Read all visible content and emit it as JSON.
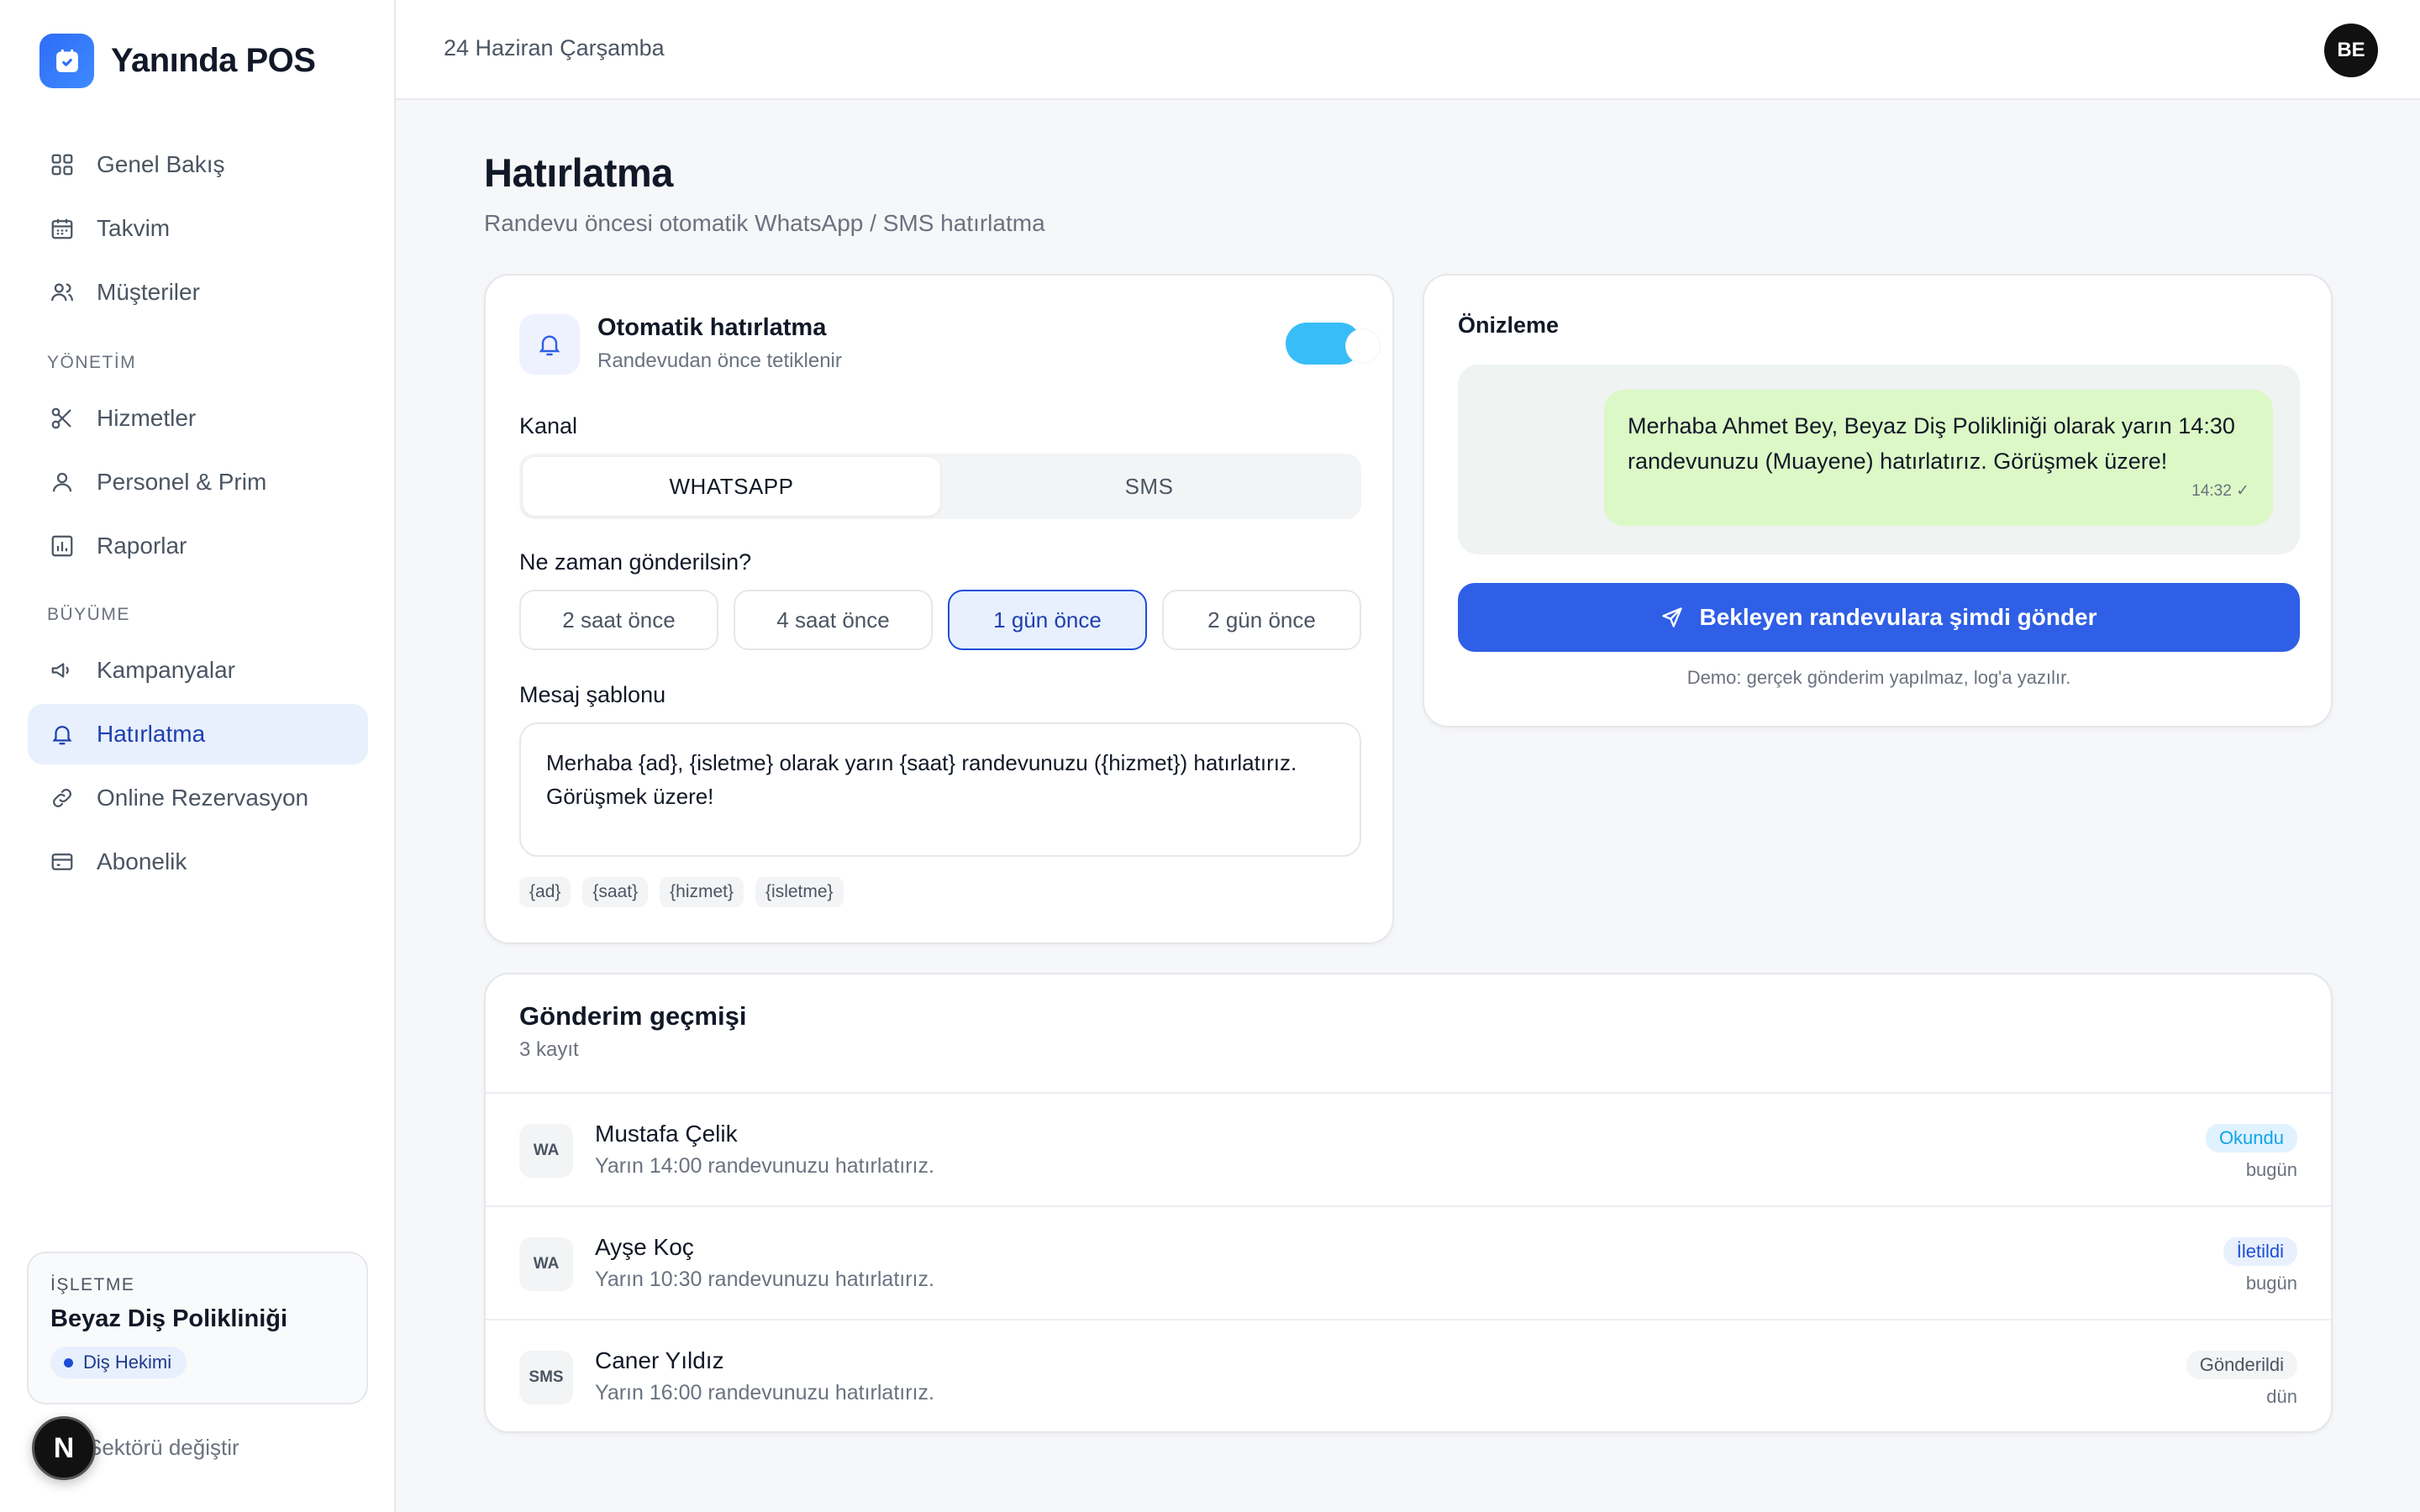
{
  "brand": {
    "name": "Yanında POS",
    "color": "#2f6cf6"
  },
  "sidebar": {
    "items_top": [
      {
        "label": "Genel Bakış",
        "icon": "grid-icon"
      },
      {
        "label": "Takvim",
        "icon": "calendar-icon"
      },
      {
        "label": "Müşteriler",
        "icon": "users-icon"
      }
    ],
    "section_management": "YÖNETİM",
    "items_management": [
      {
        "label": "Hizmetler",
        "icon": "scissors-icon"
      },
      {
        "label": "Personel & Prim",
        "icon": "user-icon"
      },
      {
        "label": "Raporlar",
        "icon": "bar-chart-icon"
      }
    ],
    "section_growth": "BÜYÜME",
    "items_growth": [
      {
        "label": "Kampanyalar",
        "icon": "megaphone-icon"
      },
      {
        "label": "Hatırlatma",
        "icon": "bell-icon",
        "active": true
      },
      {
        "label": "Online Rezervasyon",
        "icon": "link-icon"
      },
      {
        "label": "Abonelik",
        "icon": "credit-card-icon"
      }
    ],
    "business": {
      "label": "İŞLETME",
      "name": "Beyaz Diş Polikliniği",
      "sector": "Diş Hekimi"
    },
    "sector_link": "Sektörü değiştir",
    "n_badge": "N"
  },
  "topbar": {
    "date": "24 Haziran Çarşamba",
    "avatar_initials": "BE"
  },
  "page": {
    "title": "Hatırlatma",
    "subtitle": "Randevu öncesi otomatik WhatsApp / SMS hatırlatma"
  },
  "settings": {
    "title": "Otomatik hatırlatma",
    "subtitle": "Randevudan önce tetiklenir",
    "enabled": true,
    "channel_label": "Kanal",
    "channels": [
      "WHATSAPP",
      "SMS"
    ],
    "selected_channel": "WHATSAPP",
    "timing_label": "Ne zaman gönderilsin?",
    "timings": [
      "2 saat önce",
      "4 saat önce",
      "1 gün önce",
      "2 gün önce"
    ],
    "selected_timing": "1 gün önce",
    "template_label": "Mesaj şablonu",
    "template": "Merhaba {ad}, {isletme} olarak yarın {saat} randevunuzu ({hizmet}) hatırlatırız. Görüşmek üzere!",
    "placeholders": [
      "{ad}",
      "{saat}",
      "{hizmet}",
      "{isletme}"
    ]
  },
  "preview": {
    "title": "Önizleme",
    "message": "Merhaba Ahmet Bey, Beyaz Diş Polikliniği olarak yarın 14:30 randevunuzu (Muayene) hatırlatırız. Görüşmek üzere!",
    "time": "14:32 ✓",
    "send_button": "Bekleyen randevulara şimdi gönder",
    "demo_note": "Demo: gerçek gönderim yapılmaz, log'a yazılır."
  },
  "history": {
    "title": "Gönderim geçmişi",
    "count": "3 kayıt",
    "rows": [
      {
        "channel": "WA",
        "name": "Mustafa Çelik",
        "message": "Yarın 14:00 randevunuzu hatırlatırız.",
        "status": "Okundu",
        "status_type": "read",
        "when": "bugün"
      },
      {
        "channel": "WA",
        "name": "Ayşe Koç",
        "message": "Yarın 10:30 randevunuzu hatırlatırız.",
        "status": "İletildi",
        "status_type": "delivered",
        "when": "bugün"
      },
      {
        "channel": "SMS",
        "name": "Caner Yıldız",
        "message": "Yarın 16:00 randevunuzu hatırlatırız.",
        "status": "Gönderildi",
        "status_type": "sent",
        "when": "dün"
      }
    ]
  }
}
